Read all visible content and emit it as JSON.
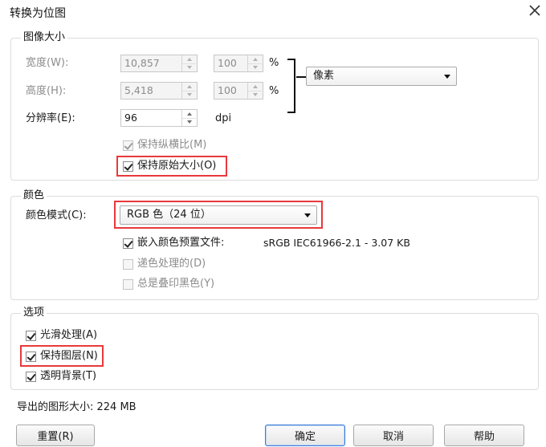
{
  "window": {
    "title": "转换为位图",
    "close_icon": "close-icon"
  },
  "image_size": {
    "legend": "图像大小",
    "width_label": "宽度(W):",
    "width_value": "10,857",
    "width_pct": "100",
    "width_pct_unit": "%",
    "height_label": "高度(H):",
    "height_value": "5,418",
    "height_pct": "100",
    "height_pct_unit": "%",
    "unit_selected": "像素",
    "resolution_label": "分辨率(E):",
    "resolution_value": "96",
    "resolution_unit": "dpi",
    "keep_aspect_label": "保持纵横比(M)",
    "keep_aspect_checked": true,
    "keep_aspect_disabled": true,
    "keep_original_size_label": "保持原始大小(O)",
    "keep_original_size_checked": true
  },
  "color": {
    "legend": "颜色",
    "mode_label": "颜色模式(C):",
    "mode_selected": "RGB 色（24 位）",
    "embed_profile_label": "嵌入颜色预置文件:",
    "embed_profile_checked": true,
    "profile_info": "sRGB IEC61966-2.1 - 3.07 KB",
    "dither_label": "递色处理的(D)",
    "dither_checked": false,
    "dither_disabled": true,
    "overprint_black_label": "总是叠印黑色(Y)",
    "overprint_black_checked": false,
    "overprint_black_disabled": true
  },
  "options": {
    "legend": "选项",
    "antialias_label": "光滑处理(A)",
    "antialias_checked": true,
    "keep_layers_label": "保持图层(N)",
    "keep_layers_checked": true,
    "transparent_bg_label": "透明背景(T)",
    "transparent_bg_checked": true
  },
  "export_size": "导出的图形大小: 224 MB",
  "buttons": {
    "reset": "重置(R)",
    "ok": "确定",
    "cancel": "取消",
    "help": "帮助"
  },
  "colors": {
    "highlight": "#e8393c",
    "default_button_border": "#3d7bd8"
  }
}
